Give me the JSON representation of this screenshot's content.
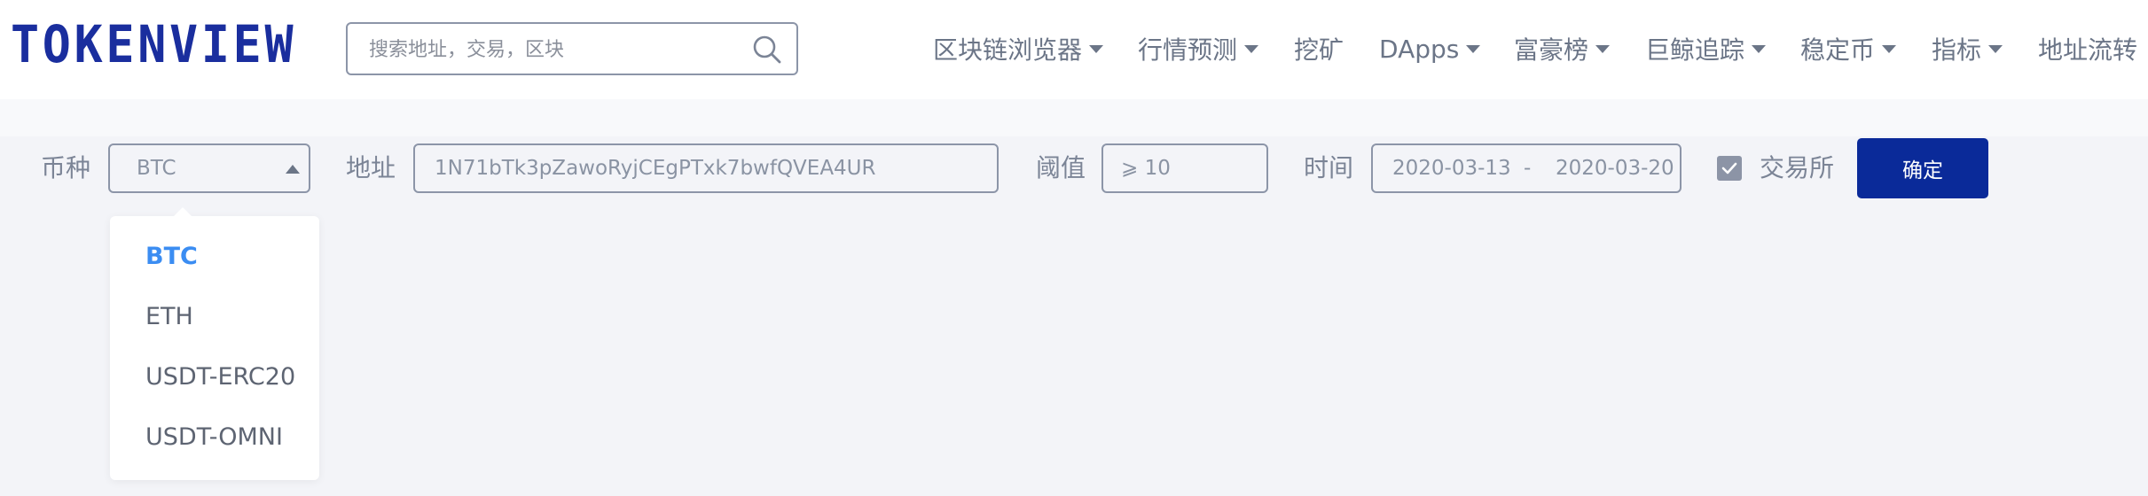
{
  "header": {
    "logo": "TOKENVIEW",
    "search_placeholder": "搜索地址，交易，区块",
    "nav": [
      {
        "label": "区块链浏览器",
        "caret": true
      },
      {
        "label": "行情预测",
        "caret": true
      },
      {
        "label": "挖矿",
        "caret": false
      },
      {
        "label": "DApps",
        "caret": true
      },
      {
        "label": "富豪榜",
        "caret": true
      },
      {
        "label": "巨鲸追踪",
        "caret": true
      },
      {
        "label": "稳定币",
        "caret": true
      },
      {
        "label": "指标",
        "caret": true
      },
      {
        "label": "地址流转",
        "caret": false
      }
    ]
  },
  "filters": {
    "coin_label": "币种",
    "coin_value": "BTC",
    "address_label": "地址",
    "address_value": "1N71bTk3pZawoRyjCEgPTxk7bwfQVEA4UR",
    "threshold_label": "阈值",
    "threshold_value": "⩾ 10",
    "time_label": "时间",
    "date_start": "2020-03-13",
    "date_sep": "-",
    "date_end": "2020-03-20",
    "exchange_label": "交易所",
    "exchange_checked": true,
    "confirm_label": "确定"
  },
  "coin_dropdown": {
    "options": [
      "BTC",
      "ETH",
      "USDT-ERC20",
      "USDT-OMNI"
    ],
    "selected": "BTC"
  },
  "colors": {
    "brand": "#1a2e9e",
    "button": "#0a2a99",
    "active_option": "#3b8df2",
    "page_bg": "#f3f4f8"
  }
}
